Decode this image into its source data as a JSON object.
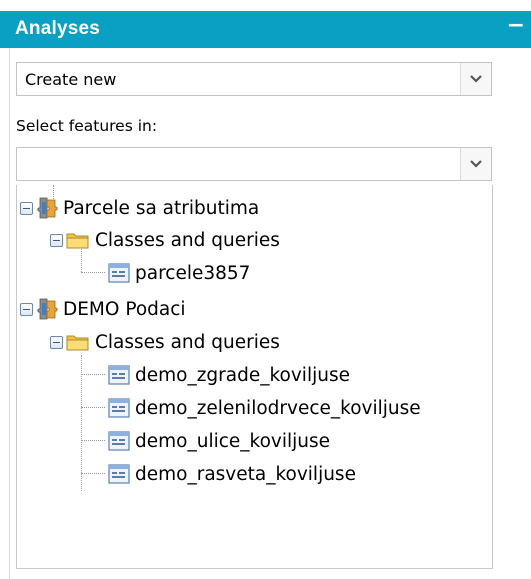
{
  "panel": {
    "title": "Analyses",
    "collapse_symbol": "−",
    "mode_select": {
      "value": "Create new"
    },
    "features_label": "Select features in:",
    "features_select": {
      "value": ""
    }
  },
  "tree": {
    "datasources": [
      {
        "label": "Parcele sa atributima",
        "groups": [
          {
            "label": "Classes and queries",
            "items": [
              "parcele3857"
            ]
          }
        ]
      },
      {
        "label": "DEMO Podaci",
        "groups": [
          {
            "label": "Classes and queries",
            "items": [
              "demo_zgrade_koviljuse",
              "demo_zelenilodrvece_koviljuse",
              "demo_ulice_koviljuse",
              "demo_rasveta_koviljuse"
            ]
          }
        ]
      }
    ]
  },
  "icons": {
    "datasource": "database-puzzle-icon",
    "group": "folder-icon",
    "item": "feature-class-icon",
    "toggle": "collapse-minus-icon",
    "dropdown": "chevron-down-icon"
  }
}
